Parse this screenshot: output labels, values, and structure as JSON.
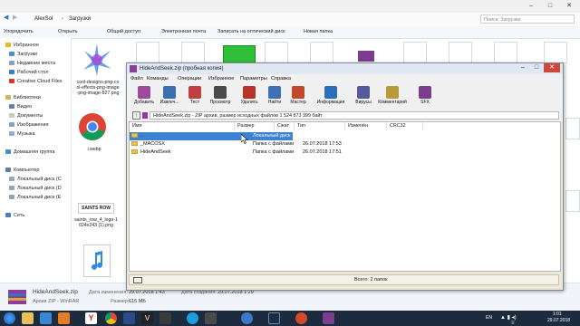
{
  "explorer": {
    "breadcrumb": [
      "AlexSol",
      "Загрузки"
    ],
    "search_placeholder": "Поиск: Загрузки",
    "toolbar": [
      "Упорядочить",
      "Открыть",
      "Общий доступ",
      "Электронная почта",
      "Записать на оптический диск",
      "Новая папка"
    ],
    "nav": [
      {
        "label": "Избранное",
        "icon": "star-icon",
        "color": "#e7b52c"
      },
      {
        "label": "Загрузки",
        "icon": "downloads-icon",
        "color": "#4d8fd1"
      },
      {
        "label": "Недавние места",
        "icon": "recent-icon",
        "color": "#8aa0b8"
      },
      {
        "label": "Рабочий стол",
        "icon": "desktop-icon",
        "color": "#3e79c6"
      },
      {
        "label": "Creative Cloud Files",
        "icon": "creative-cloud-icon",
        "color": "#d9342b"
      },
      {
        "label": "Библиотеки",
        "icon": "libraries-icon",
        "color": "#d8b25a"
      },
      {
        "label": "Видео",
        "icon": "video-icon",
        "color": "#6a7fa0"
      },
      {
        "label": "Документы",
        "icon": "documents-icon",
        "color": "#c8c8c8"
      },
      {
        "label": "Изображения",
        "icon": "pictures-icon",
        "color": "#7fa4c4"
      },
      {
        "label": "Музыка",
        "icon": "music-icon",
        "color": "#8ab0d8"
      },
      {
        "label": "Домашняя группа",
        "icon": "homegroup-icon",
        "color": "#3f8ed6"
      },
      {
        "label": "Компьютер",
        "icon": "computer-icon",
        "color": "#5c7ea8"
      },
      {
        "label": "Локальный диск (C",
        "icon": "drive-icon",
        "color": "#9aa4ae"
      },
      {
        "label": "Локальный диск (D",
        "icon": "drive-icon",
        "color": "#9aa4ae"
      },
      {
        "label": "Локальный диск (E",
        "icon": "drive-icon",
        "color": "#9aa4ae"
      },
      {
        "label": "Сеть",
        "icon": "network-icon",
        "color": "#4b7fb8"
      }
    ],
    "files": [
      {
        "caption": "cool-designs-png-cool-effects-png-image-png-image-827.png",
        "icon": "image-file-icon"
      },
      {
        "caption": "i.webp",
        "icon": "chrome-file-icon"
      },
      {
        "caption": "saints_row_4_logo-1024x243 (1).png",
        "icon": "image-file-icon"
      },
      {
        "caption": "",
        "icon": "audio-file-icon"
      }
    ],
    "status": {
      "file_name": "HideAndSeek.zip",
      "file_type": "Архив ZIP - WinRAR",
      "modified_label": "Дата изменения:",
      "modified_value": "29.07.2018 1:43",
      "created_label": "Дата создания:",
      "created_value": "29.07.2018 1:29",
      "size_label": "Размер:",
      "size_value": "616 МБ"
    }
  },
  "winrar": {
    "title": "HideAndSeek.zip (пробная копия)",
    "menu": [
      "Файл",
      "Команды",
      "Операции",
      "Избранное",
      "Параметры",
      "Справка"
    ],
    "tools": [
      {
        "label": "Добавить",
        "icon": "add-icon",
        "color": "#9c4a9c"
      },
      {
        "label": "Извлеч...",
        "icon": "extract-icon",
        "color": "#3b6fb0"
      },
      {
        "label": "Тест",
        "icon": "test-icon",
        "color": "#c04040"
      },
      {
        "label": "Просмотр",
        "icon": "view-icon",
        "color": "#4a4a4a"
      },
      {
        "label": "Удалить",
        "icon": "delete-icon",
        "color": "#b8332a"
      },
      {
        "label": "Найти",
        "icon": "find-icon",
        "color": "#3d70b5"
      },
      {
        "label": "Мастер",
        "icon": "wizard-icon",
        "color": "#c24a2b"
      },
      {
        "label": "Информация",
        "icon": "info-icon",
        "color": "#2c6fb8"
      },
      {
        "label": "Вирусы",
        "icon": "virus-icon",
        "color": "#555a9a"
      },
      {
        "label": "Комментарий",
        "icon": "comment-icon",
        "color": "#b89a3a"
      },
      {
        "label": "SFX",
        "icon": "sfx-icon",
        "color": "#7a3d8f"
      }
    ],
    "path_text": "HideAndSeek.zip - ZIP архив, размер исходных файлов 1 524 873 399 байт",
    "columns": [
      "Имя",
      "Размер",
      "Сжат",
      "Тип",
      "Изменён",
      "CRC32"
    ],
    "rows": [
      {
        "name": "..",
        "size": "",
        "packed": "",
        "type": "Локальный диск",
        "modified": "",
        "crc": "",
        "selected": true
      },
      {
        "name": "_MACOSX",
        "size": "",
        "packed": "",
        "type": "Папка с файлами",
        "modified": "26.07.2018 17:53",
        "crc": "",
        "selected": false
      },
      {
        "name": "HideAndSeek",
        "size": "",
        "packed": "",
        "type": "Папка с файлами",
        "modified": "26.07.2018 17:51",
        "crc": "",
        "selected": false
      }
    ],
    "status_text": "Всего: 2 папок",
    "selection_color": "#3b82d4"
  },
  "taskbar": {
    "apps": [
      {
        "icon": "start-button-icon",
        "color": "#2d6db5"
      },
      {
        "icon": "explorer-icon",
        "color": "#e8c15a"
      },
      {
        "icon": "ie-icon",
        "color": "#3a86d6"
      },
      {
        "icon": "media-player-icon",
        "color": "#e57a28"
      },
      {
        "icon": "yandex-icon",
        "color": "#ffffff"
      },
      {
        "icon": "chrome-icon",
        "color": "#e8453c"
      },
      {
        "icon": "photoshop-icon",
        "color": "#2a4a8a"
      },
      {
        "icon": "vegas-icon",
        "color": "#222222"
      },
      {
        "icon": "movie-icon",
        "color": "#3a3a3a"
      },
      {
        "icon": "skype-icon",
        "color": "#1a9ee0"
      },
      {
        "icon": "settings-icon",
        "color": "#4a4a4a"
      },
      {
        "icon": "globe-icon",
        "color": "#3a7ac8"
      },
      {
        "icon": "steam-icon",
        "color": "#1d2b42"
      },
      {
        "icon": "bandicam-icon",
        "color": "#d24a2a"
      },
      {
        "icon": "winrar-icon",
        "color": "#7a3d8f"
      }
    ],
    "lang": "EN",
    "time": "1:01",
    "date": "29.07.2018"
  }
}
